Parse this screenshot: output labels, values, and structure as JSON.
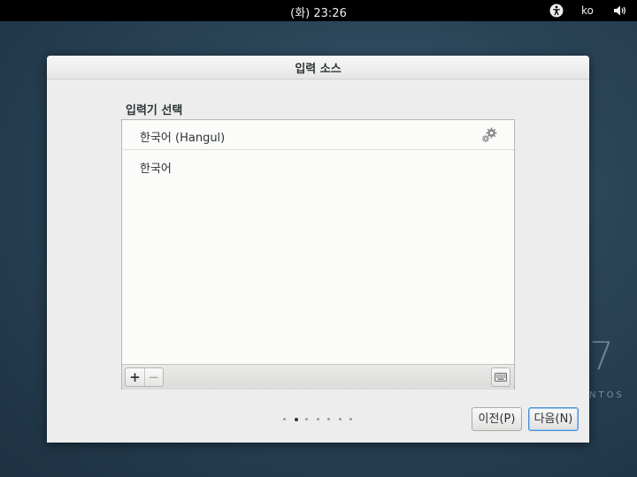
{
  "topbar": {
    "clock": "(화) 23:26",
    "language": "ko",
    "accessibility_icon": "accessibility-icon",
    "volume_icon": "volume-icon"
  },
  "background": {
    "brand_number": "7",
    "brand_text": "NTOS"
  },
  "dialog": {
    "title": "입력 소스",
    "section_label": "입력기 선택",
    "input_sources": [
      {
        "label": "한국어 (Hangul)",
        "has_settings": true
      },
      {
        "label": "한국어",
        "has_settings": false
      }
    ],
    "toolbar": {
      "add_label": "+",
      "remove_label": "−",
      "keyboard_icon": "keyboard-icon"
    },
    "pager": {
      "total": 7,
      "current": 2
    },
    "buttons": {
      "previous": "이전(P)",
      "next": "다음(N)"
    }
  }
}
